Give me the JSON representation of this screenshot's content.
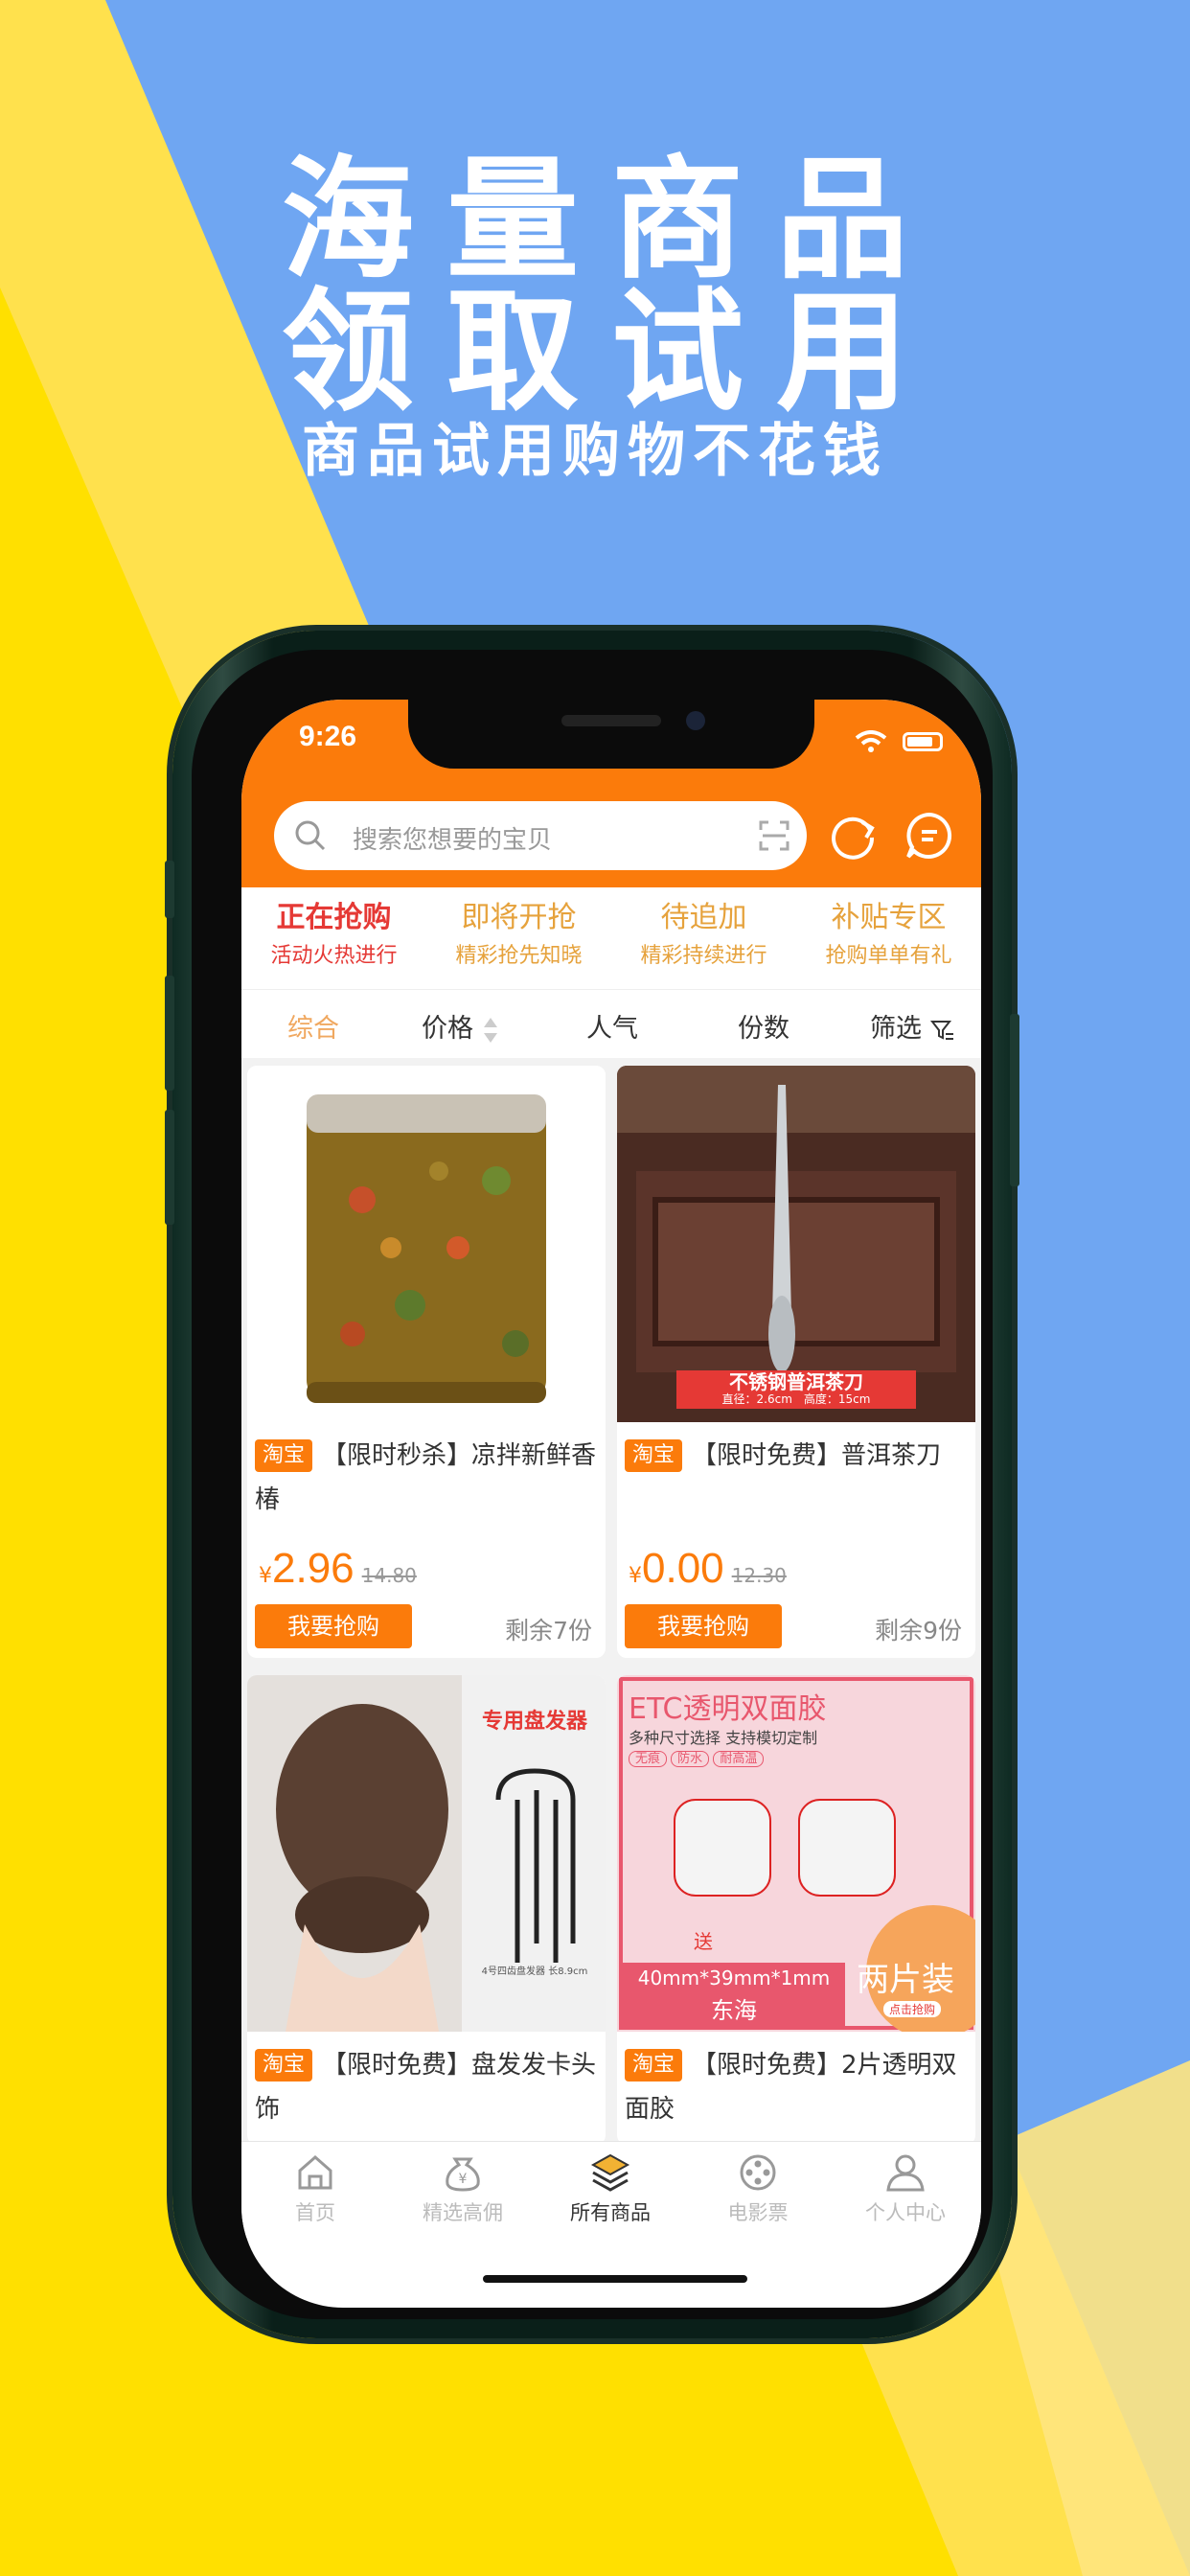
{
  "promo": {
    "line1": "海量商品",
    "line2": "领取试用",
    "line3": "商品试用购物不花钱"
  },
  "status": {
    "time": "9:26"
  },
  "search": {
    "placeholder": "搜索您想要的宝贝"
  },
  "tabs": [
    {
      "title": "正在抢购",
      "sub": "活动火热进行",
      "active": true
    },
    {
      "title": "即将开抢",
      "sub": "精彩抢先知晓",
      "active": false
    },
    {
      "title": "待追加",
      "sub": "精彩持续进行",
      "active": false
    },
    {
      "title": "补贴专区",
      "sub": "抢购单单有礼",
      "active": false
    }
  ],
  "sort": {
    "comprehensive": "综合",
    "price": "价格",
    "popularity": "人气",
    "quantity": "份数",
    "filter": "筛选"
  },
  "products": [
    {
      "tag": "淘宝",
      "title": "【限时秒杀】凉拌新鲜香椿",
      "yen": "¥",
      "price": "2.96",
      "old_price": "14.80",
      "buy": "我要抢购",
      "remain": "剩余7份"
    },
    {
      "tag": "淘宝",
      "title": "【限时免费】普洱茶刀",
      "yen": "¥",
      "price": "0.00",
      "old_price": "12.30",
      "buy": "我要抢购",
      "remain": "剩余9份",
      "img_text": "不锈钢普洱茶刀",
      "img_subtext": "直径：2.6cm　高度：15cm"
    },
    {
      "tag": "淘宝",
      "title": "【限时免费】盘发发卡头饰",
      "img_text": "专用盘发器",
      "img_subtext": "4号四齿盘发器 长8.9cm"
    },
    {
      "tag": "淘宝",
      "title": "【限时免费】2片透明双面胶",
      "img_text": "ETC透明双面胶",
      "img_subtext": "多种尺寸选择 支持模切定制",
      "img_badges": [
        "无痕",
        "防水",
        "耐高温"
      ],
      "img_size": "40mm*39mm*1mm",
      "img_city": "东海",
      "img_pack": "两片装",
      "img_cta": "点击抢购",
      "img_gift": "送"
    }
  ],
  "bottom_nav": [
    {
      "label": "首页",
      "icon": "home-icon",
      "active": false
    },
    {
      "label": "精选高佣",
      "icon": "money-bag-icon",
      "active": false
    },
    {
      "label": "所有商品",
      "icon": "layers-icon",
      "active": true
    },
    {
      "label": "电影票",
      "icon": "film-reel-icon",
      "active": false
    },
    {
      "label": "个人中心",
      "icon": "user-icon",
      "active": false
    }
  ],
  "colors": {
    "accent": "#fb7b0b",
    "active_tab": "#e53935",
    "bg_blue": "#6fa6f2",
    "bg_yellow": "#ffe000"
  }
}
